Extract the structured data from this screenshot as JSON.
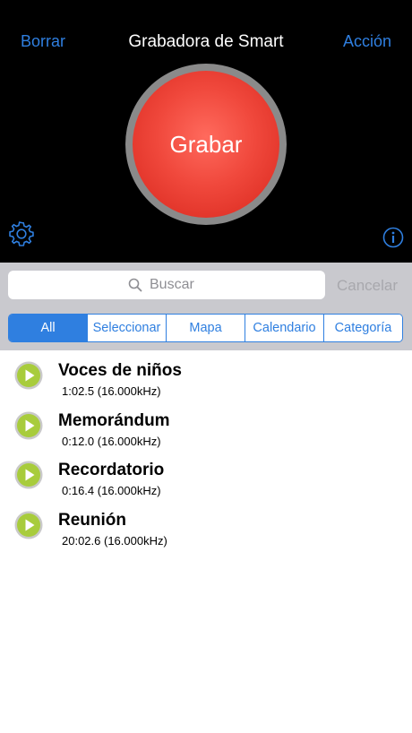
{
  "header": {
    "left_action": "Borrar",
    "title": "Grabadora de Smart",
    "right_action": "Acción"
  },
  "record": {
    "label": "Grabar"
  },
  "icons": {
    "settings": "gear-icon",
    "info": "info-icon",
    "search": "search-icon",
    "play": "play-icon"
  },
  "search": {
    "placeholder": "Buscar",
    "cancel": "Cancelar"
  },
  "segments": [
    {
      "label": "All",
      "active": true
    },
    {
      "label": "Seleccionar",
      "active": false
    },
    {
      "label": "Mapa",
      "active": false
    },
    {
      "label": "Calendario",
      "active": false
    },
    {
      "label": "Categoría",
      "active": false
    }
  ],
  "recordings": [
    {
      "title": "Voces de niños",
      "detail": "1:02.5 (16.000kHz)"
    },
    {
      "title": "Memorándum",
      "detail": "0:12.0 (16.000kHz)"
    },
    {
      "title": "Recordatorio",
      "detail": "0:16.4 (16.000kHz)"
    },
    {
      "title": "Reunión",
      "detail": "20:02.6 (16.000kHz)"
    }
  ],
  "colors": {
    "accent": "#2f7fe0",
    "record_red": "#f0483c",
    "play_green": "#a8cc3c",
    "top_background": "#000000"
  }
}
